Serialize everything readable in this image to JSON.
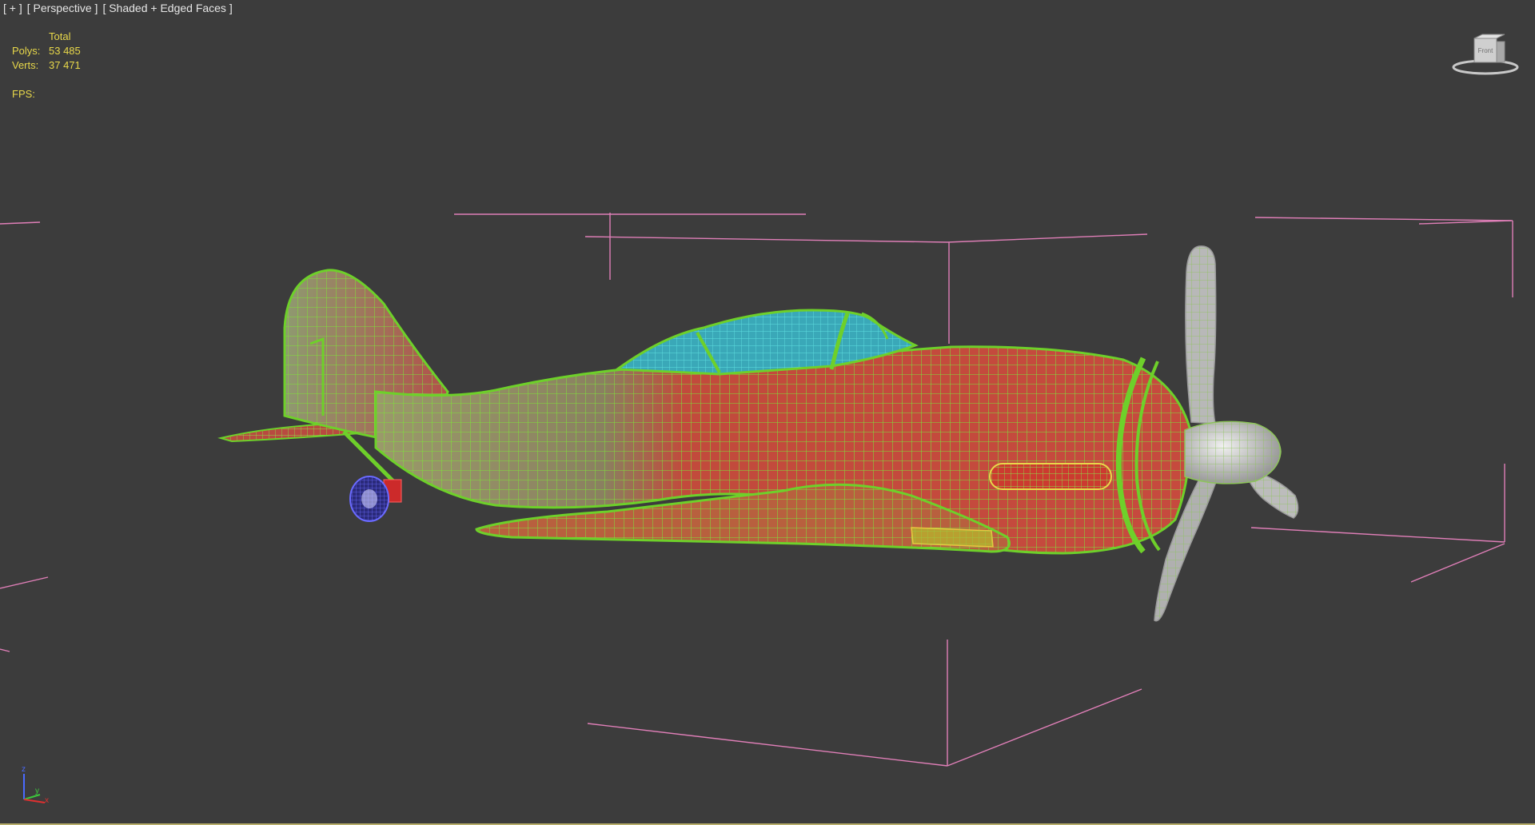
{
  "viewport": {
    "menu": {
      "plus": "[ + ]",
      "view": "[ Perspective ]",
      "shading": "[ Shaded + Edged Faces ]"
    },
    "stats": {
      "header": "Total",
      "polys_label": "Polys:",
      "polys_value": "53 485",
      "verts_label": "Verts:",
      "verts_value": "37 471",
      "fps_label": "FPS:"
    },
    "viewcube": {
      "face_label": "Front",
      "icon": "viewcube-icon"
    },
    "axis_tripod": {
      "z_label": "z",
      "y_label": "y",
      "x_label": "x",
      "icon": "axis-tripod-icon"
    },
    "colors": {
      "background": "#3c3c3c",
      "wire": "#6ed02a",
      "body": "#c94a3e",
      "canopy": "#3fc4c4",
      "propeller": "#bdbdbd",
      "bounding_box": "#e07fb8",
      "stats_text": "#e8d84a",
      "wheel": "#5050d8"
    }
  }
}
